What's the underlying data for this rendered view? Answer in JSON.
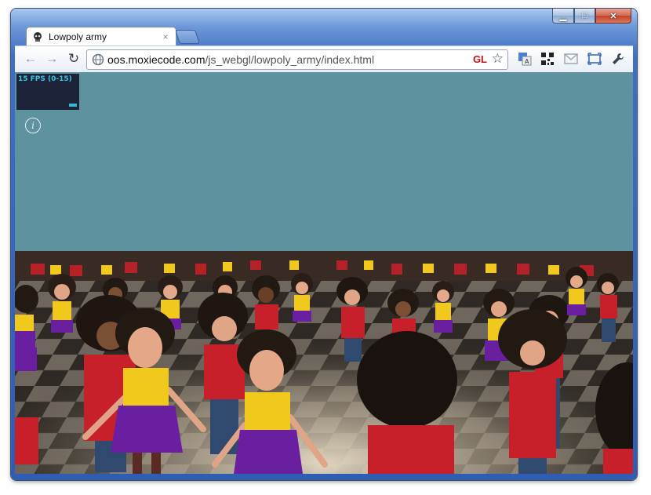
{
  "tab": {
    "title": "Lowpoly army",
    "close_glyph": "×"
  },
  "window_controls": {
    "minimize": "▁",
    "maximize": "□",
    "close": "✕"
  },
  "toolbar": {
    "back": "←",
    "forward": "→",
    "reload": "↻"
  },
  "omnibox": {
    "host": "oos.moxiecode.com",
    "path": "/js_webgl/lowpoly_army/index.html",
    "gl_badge": "GL",
    "star": "☆"
  },
  "extensions": [
    "translate-icon",
    "qr-code-icon",
    "mail-icon",
    "fullscreen-icon",
    "wrench-icon"
  ],
  "page": {
    "fps_label": "15 FPS (0-15)",
    "info_glyph": "i"
  },
  "colors": {
    "sky": "#5e929e",
    "stats_bg": "#1c2237",
    "fps_text": "#38c6e0",
    "shirt_red": "#c8202a",
    "shirt_yellow": "#f2cc1c",
    "skirt_purple": "#6a1ea0"
  }
}
